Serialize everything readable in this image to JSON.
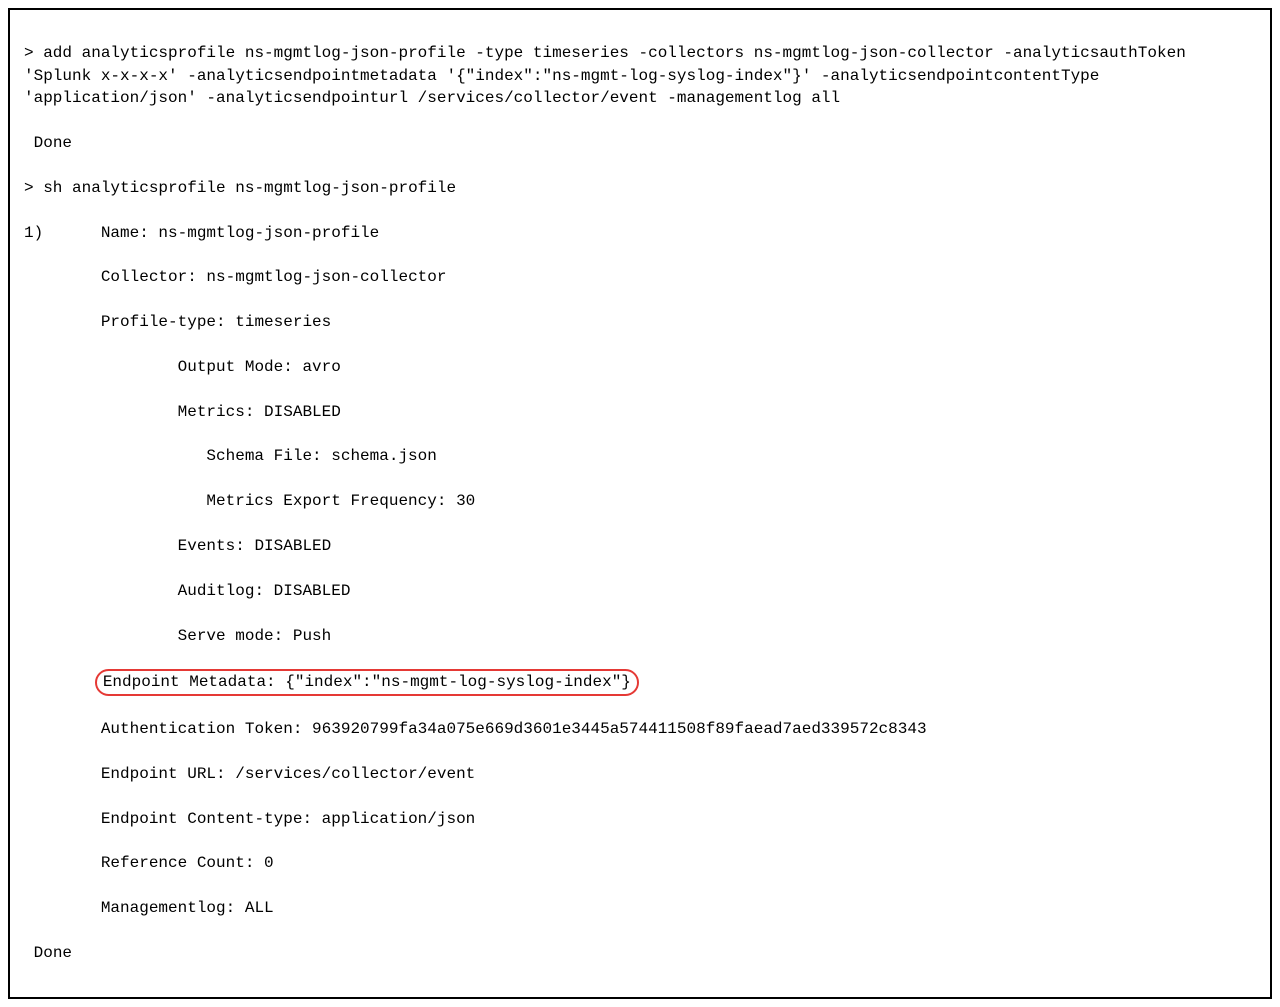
{
  "cmd1": "add analyticsprofile ns-mgmtlog-json-profile -type timeseries -collectors ns-mgmtlog-json-collector -analyticsauthToken 'Splunk x-x-x-x' -analyticsendpointmetadata '{\"index\":\"ns-mgmt-log-syslog-index\"}' -analyticsendpointcontentType 'application/json' -analyticsendpointurl /services/collector/event -managementlog all",
  "cmd1_resp": " Done",
  "cmd2": "sh analyticsprofile ns-mgmtlog-json-profile",
  "output": {
    "num": "1)",
    "name": "Name: ns-mgmtlog-json-profile",
    "collector": "Collector: ns-mgmtlog-json-collector",
    "profile_type": "Profile-type: timeseries",
    "output_mode": "Output Mode: avro",
    "metrics": "Metrics: DISABLED",
    "schema_file": "Schema File: schema.json",
    "metrics_freq": "Metrics Export Frequency: 30",
    "events": "Events: DISABLED",
    "auditlog": "Auditlog: DISABLED",
    "serve_mode": "Serve mode: Push",
    "endpoint_meta": "Endpoint Metadata: {\"index\":\"ns-mgmt-log-syslog-index\"}",
    "auth_token": "Authentication Token: 963920799fa34a075e669d3601e3445a574411508f89faead7aed339572c8343",
    "endpoint_url": "Endpoint URL: /services/collector/event",
    "endpoint_ct": "Endpoint Content-type: application/json",
    "ref_count": "Reference Count: 0",
    "mgmtlog": "Managementlog: ALL"
  },
  "done": " Done"
}
